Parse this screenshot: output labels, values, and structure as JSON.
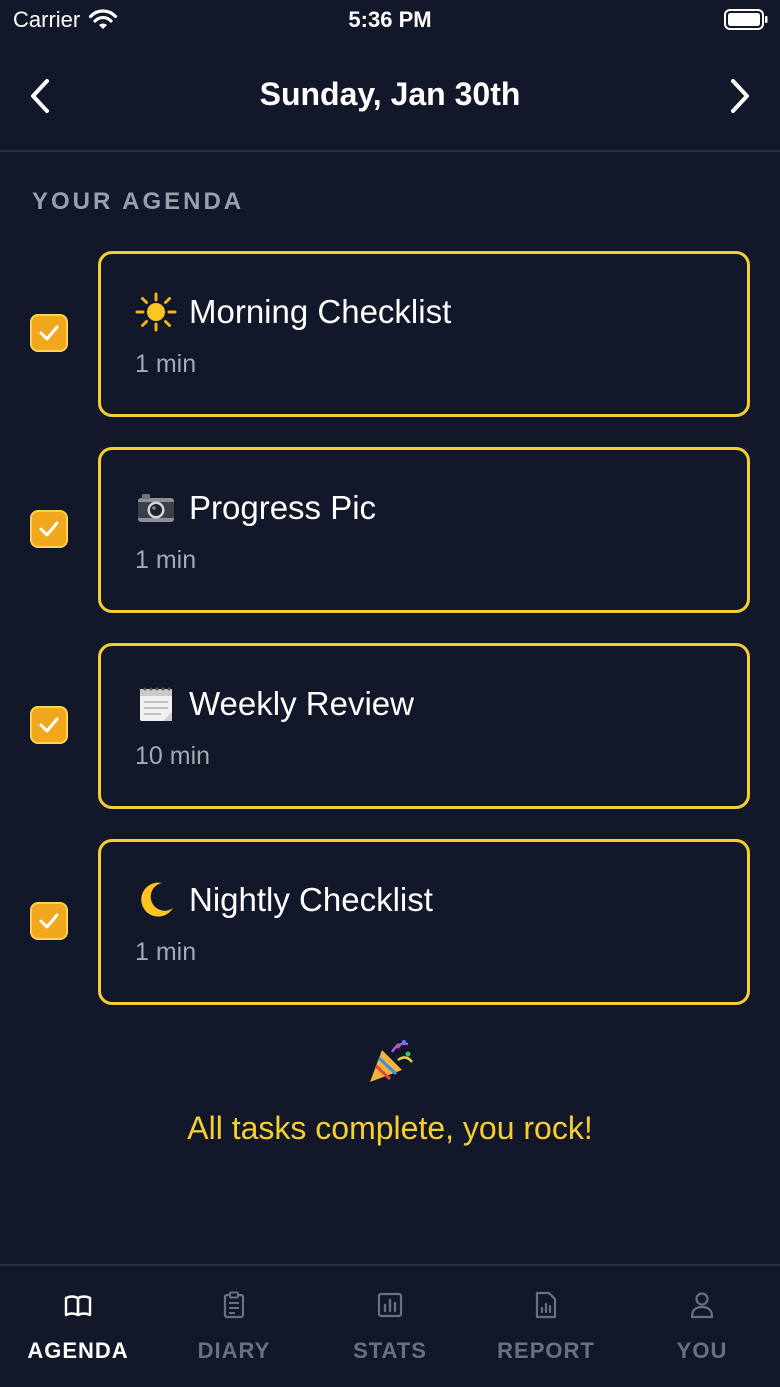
{
  "status_bar": {
    "carrier": "Carrier",
    "time": "5:36 PM"
  },
  "header": {
    "title": "Sunday, Jan 30th"
  },
  "agenda": {
    "section_label": "YOUR AGENDA",
    "tasks": [
      {
        "icon": "sun-icon",
        "title": "Morning Checklist",
        "duration": "1 min",
        "checked": true
      },
      {
        "icon": "camera-icon",
        "title": "Progress Pic",
        "duration": "1 min",
        "checked": true
      },
      {
        "icon": "calendar-icon",
        "title": "Weekly Review",
        "duration": "10 min",
        "checked": true
      },
      {
        "icon": "moon-icon",
        "title": "Nightly Checklist",
        "duration": "1 min",
        "checked": true
      }
    ],
    "complete_message": "All tasks complete, you rock!"
  },
  "tabs": [
    {
      "label": "AGENDA",
      "icon": "book-icon",
      "active": true
    },
    {
      "label": "DIARY",
      "icon": "clipboard-icon",
      "active": false
    },
    {
      "label": "STATS",
      "icon": "bar-chart-icon",
      "active": false
    },
    {
      "label": "REPORT",
      "icon": "report-icon",
      "active": false
    },
    {
      "label": "YOU",
      "icon": "user-icon",
      "active": false
    }
  ],
  "colors": {
    "background": "#121729",
    "accent": "#f5cf2f",
    "checkbox": "#f2a81d",
    "muted": "#9a9faa",
    "tab_inactive": "#6b7080"
  }
}
